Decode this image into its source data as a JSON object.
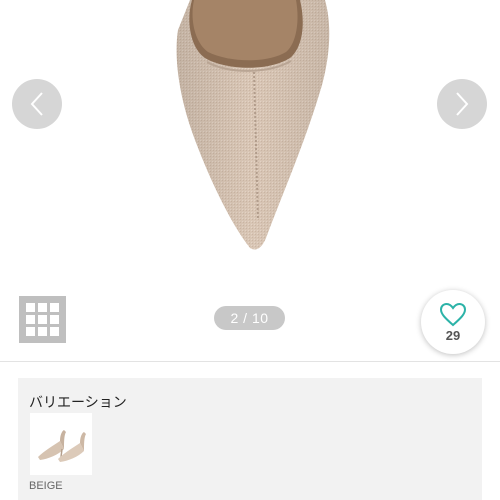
{
  "gallery": {
    "page_indicator": "2 / 10",
    "favorite_count": "29",
    "colors": {
      "accent": "#2cb3a8",
      "arrow_bg": "#cfcfcf",
      "indicator_bg": "#c8c8c8",
      "grid_bg": "#bfbfbf"
    },
    "icons": {
      "prev": "chevron-left-icon",
      "next": "chevron-right-icon",
      "grid": "grid-icon",
      "favorite": "heart-icon"
    }
  },
  "variation": {
    "heading": "バリエーション",
    "items": [
      {
        "label": "BEIGE"
      }
    ]
  }
}
